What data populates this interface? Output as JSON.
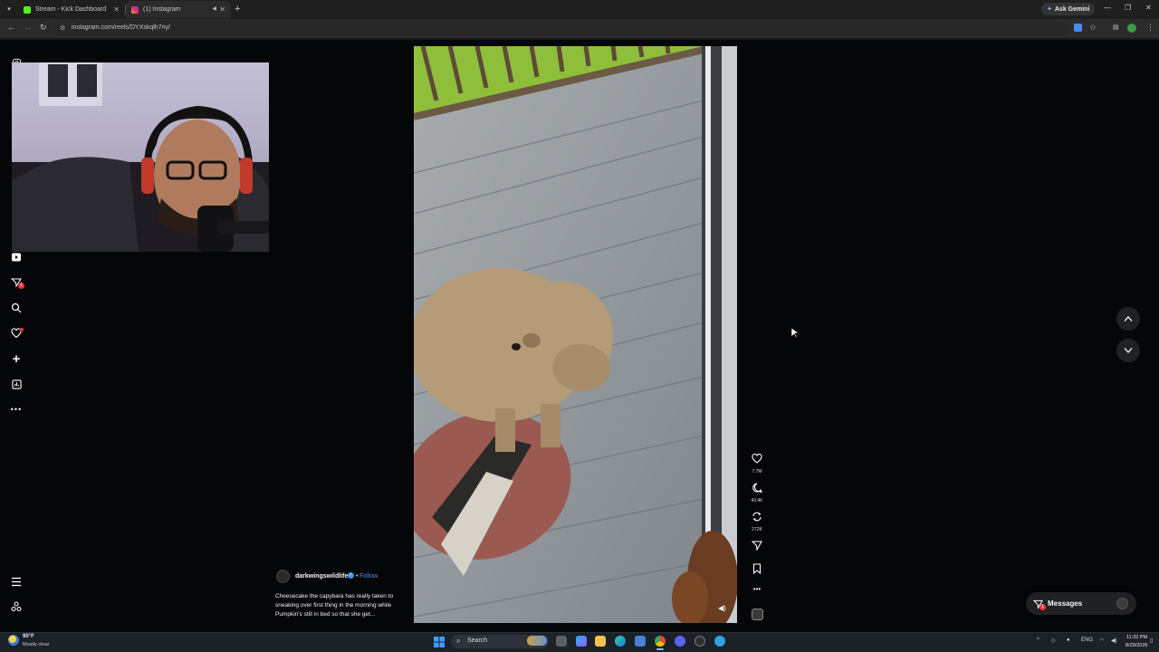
{
  "browser": {
    "tabs": [
      {
        "title": "Stream - Kick Dashboard",
        "favicon_color": "#53fc18"
      },
      {
        "title": "(1) Instagram",
        "favicon_color": "#e1306c"
      }
    ],
    "ask_gemini_label": "Ask Gemini",
    "url": "instagram.com/reels/DYXskqlh7ny/"
  },
  "reel": {
    "likes": "7.7M",
    "comments": "43.4K",
    "reposts": "272K",
    "author": "darkwingswildlife",
    "follow_label": "Follow",
    "dot": "•",
    "caption": "Cheesecake the capybara has really taken to sneaking over first thing in the morning while Pumpkin's still in bed so that she get..."
  },
  "nav": {
    "notifications_badge": "1"
  },
  "messages": {
    "label": "Messages",
    "badge": "1"
  },
  "taskbar": {
    "weather_temp": "90°F",
    "weather_desc": "Mostly clear",
    "search_label": "Search",
    "lang": "ENG",
    "time": "11:32 PM",
    "date": "8/29/2026"
  },
  "colors": {
    "accent_blue": "#4a8cf5",
    "badge_red": "#ff3040",
    "page_bg": "#050607"
  }
}
